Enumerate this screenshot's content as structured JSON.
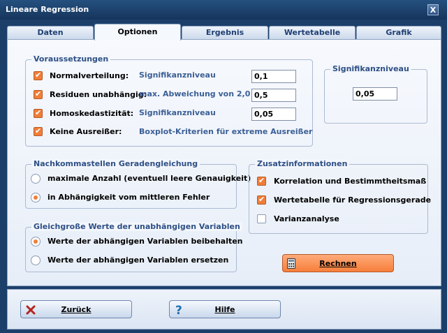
{
  "window": {
    "title": "Lineare Regression",
    "close_glyph": "X"
  },
  "tabs": [
    {
      "label": "Daten",
      "active": false
    },
    {
      "label": "Optionen",
      "active": true
    },
    {
      "label": "Ergebnis",
      "active": false
    },
    {
      "label": "Wertetabelle",
      "active": false
    },
    {
      "label": "Grafik",
      "active": false
    }
  ],
  "voraussetzungen": {
    "title": "Voraussetzungen",
    "rows": [
      {
        "label": "Normalverteilung:",
        "checked": true,
        "hint": "Signifikanzniveau",
        "value": "0,1"
      },
      {
        "label": "Residuen unabhängig:",
        "checked": true,
        "hint": "max. Abweichung von 2,0",
        "value": "0,5"
      },
      {
        "label": "Homoskedastizität:",
        "checked": true,
        "hint": "Signifikanzniveau",
        "value": "0,05"
      },
      {
        "label": "Keine Ausreißer:",
        "checked": true,
        "hint": "Boxplot-Kriterien für extreme Ausreißer",
        "value": ""
      }
    ]
  },
  "signifikanz": {
    "title": "Signifikanzniveau",
    "value": "0,05"
  },
  "nachkomma": {
    "title": "Nachkommastellen Geradengleichung",
    "options": [
      {
        "label": "maximale Anzahl  (eventuell leere Genauigkeit)",
        "selected": false
      },
      {
        "label": "in Abhängigkeit vom mittleren Fehler",
        "selected": true
      }
    ]
  },
  "gleichgross": {
    "title": "Gleichgroße Werte der unabhängigen Variablen",
    "options": [
      {
        "label": "Werte der abhängigen Variablen beibehalten",
        "selected": true
      },
      {
        "label": "Werte der abhängigen Variablen ersetzen",
        "selected": false
      }
    ]
  },
  "zusatz": {
    "title": "Zusatzinformationen",
    "items": [
      {
        "label": "Korrelation und Bestimmtheitsmaß",
        "checked": true
      },
      {
        "label": "Wertetabelle für Regressionsgerade",
        "checked": true
      },
      {
        "label": "Varianzanalyse",
        "checked": false
      }
    ]
  },
  "buttons": {
    "rechnen": "Rechnen",
    "zurueck": "Zurück",
    "hilfe": "Hilfe"
  },
  "colors": {
    "accent": "#f07e3a",
    "frame": "#1c3f6a",
    "group_title": "#2e4f84"
  }
}
